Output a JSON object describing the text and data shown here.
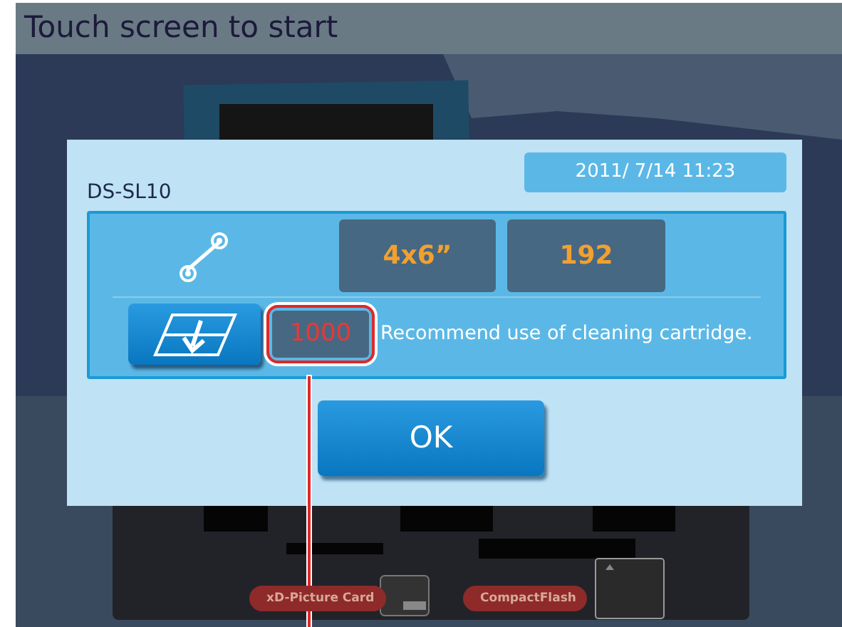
{
  "screen": {
    "title": "Touch screen to start"
  },
  "dialog": {
    "model": "DS-SL10",
    "datetime": "2011/ 7/14 11:23",
    "paper_size": "4x6”",
    "remaining": "192",
    "cleaning_count": "1000",
    "message": "Recommend use of cleaning cartridge.",
    "ok_button": "OK"
  },
  "slots": [
    {
      "label": "xD-Picture Card"
    },
    {
      "label": "CompactFlash"
    }
  ]
}
